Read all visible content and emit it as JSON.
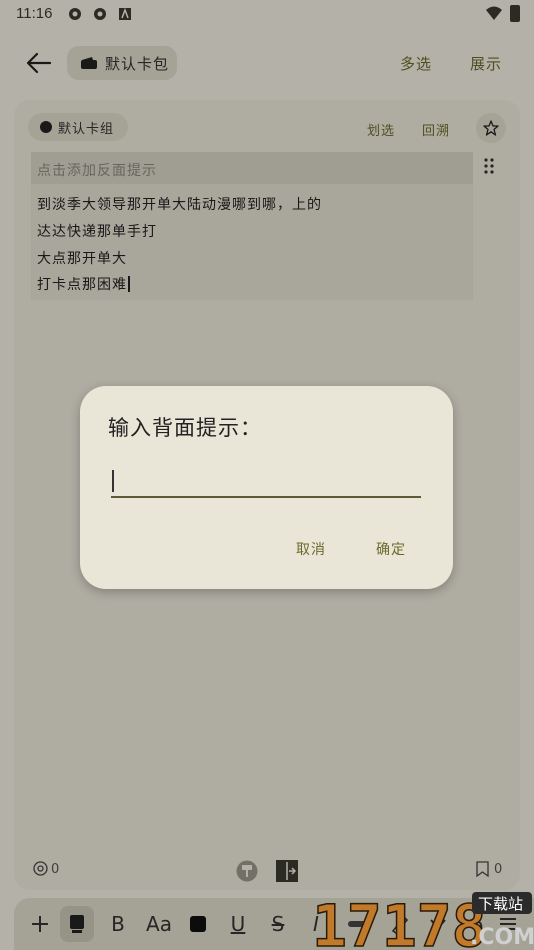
{
  "status_bar": {
    "time": "11:16"
  },
  "app_bar": {
    "wallet_label": "默认卡包",
    "multi_select": "多选",
    "expand": "展示"
  },
  "card": {
    "group_label": "默认卡组",
    "draw": "划选",
    "backtrack": "回溯",
    "back_hint_placeholder": "点击添加反面提示",
    "lines": [
      "到淡季大领导那开单大陆动漫哪到哪，上的",
      "达达快递那单手打",
      "大点那开单大",
      "打卡点那困难"
    ],
    "mention_count": "0",
    "bookmark_count": "0"
  },
  "toolbar": {
    "bold": "B",
    "font_size": "Aa",
    "underline": "U",
    "strike": "S",
    "italic": "I"
  },
  "dialog": {
    "title": "输入背面提示：",
    "input_value": "",
    "cancel": "取消",
    "confirm": "确定"
  },
  "watermark": {
    "number": "17178",
    "tag": "下载站",
    "suffix": ".COM"
  },
  "colors": {
    "background": "#efece0",
    "accent": "#6b6a2c",
    "chip": "#dcd8c8"
  }
}
